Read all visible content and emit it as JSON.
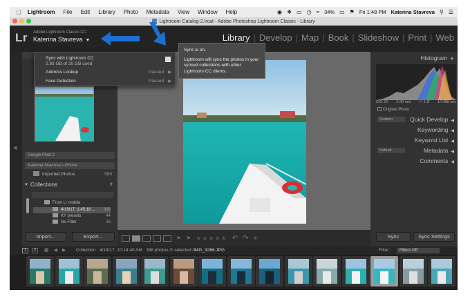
{
  "menubar": {
    "app_name": "Lightroom",
    "items": [
      "File",
      "Edit",
      "Library",
      "Photo",
      "Metadata",
      "View",
      "Window",
      "Help"
    ],
    "battery": "34%",
    "datetime": "Fri 1:48 PM",
    "user": "Katerina Stavreva"
  },
  "window": {
    "title": "Lightroom Catalog-2.lrcat - Adobe Photoshop Lightroom Classic - Library"
  },
  "identity": {
    "logo": "Lr",
    "subtitle": "Adobe Lightroom Classic CC",
    "user": "Katerina Stavreva"
  },
  "modules": [
    "Library",
    "Develop",
    "Map",
    "Book",
    "Slideshow",
    "Print",
    "Web"
  ],
  "sync_menu": {
    "title": "Sync with Lightroom CC",
    "usage": "2.93 GB of 20 GB used",
    "rows": [
      {
        "label": "Address Lookup",
        "status": "Paused"
      },
      {
        "label": "Face Detection",
        "status": "Paused"
      }
    ],
    "tooltip_title": "Sync is on.",
    "tooltip_body": "Lightroom will sync the photos in your synced collections with other Lightroom CC clients."
  },
  "left_panel": {
    "devices": [
      "Google Pixel 2",
      "Katerina Stavreva's iPhone"
    ],
    "imported": {
      "label": "Imported Photos",
      "count": "589"
    },
    "collections_title": "Collections",
    "tree": [
      {
        "label": "From Lr mobile",
        "count": ""
      },
      {
        "label": "4/19/17, 1:45:18 ...",
        "count": "398"
      },
      {
        "label": "KY presets",
        "count": "44"
      },
      {
        "label": "No Filter",
        "count": "16"
      }
    ],
    "import_label": "Import...",
    "export_label": "Export..."
  },
  "right_panel": {
    "histogram_title": "Histogram",
    "iso": "ISO 20",
    "focal": "3.99 mm",
    "aperture": "f / 1.8",
    "shutter": "1/1488 sec",
    "original_photo": "Original Photo",
    "quick_develop": "Quick Develop",
    "qd_preset": "Custom",
    "keywording": "Keywording",
    "keyword_list": "Keyword List",
    "metadata": "Metadata",
    "metadata_preset": "Default",
    "comments": "Comments",
    "sync_label": "Sync",
    "sync_settings_label": "Sync Settings"
  },
  "filmstrip_bar": {
    "page1": "1",
    "page2": "2",
    "path_prefix": "Collection : 4/19/17, 10:14:40 AM",
    "summary": "398 photos /1 selected /",
    "filename": "IMG_9266.JPG",
    "filter_label": "Filter :",
    "filter_value": "Filters Off"
  },
  "colors": {
    "accent_blue": "#1f6fd1",
    "panel_bg": "#323232",
    "app_bg": "#2b2b2b"
  }
}
